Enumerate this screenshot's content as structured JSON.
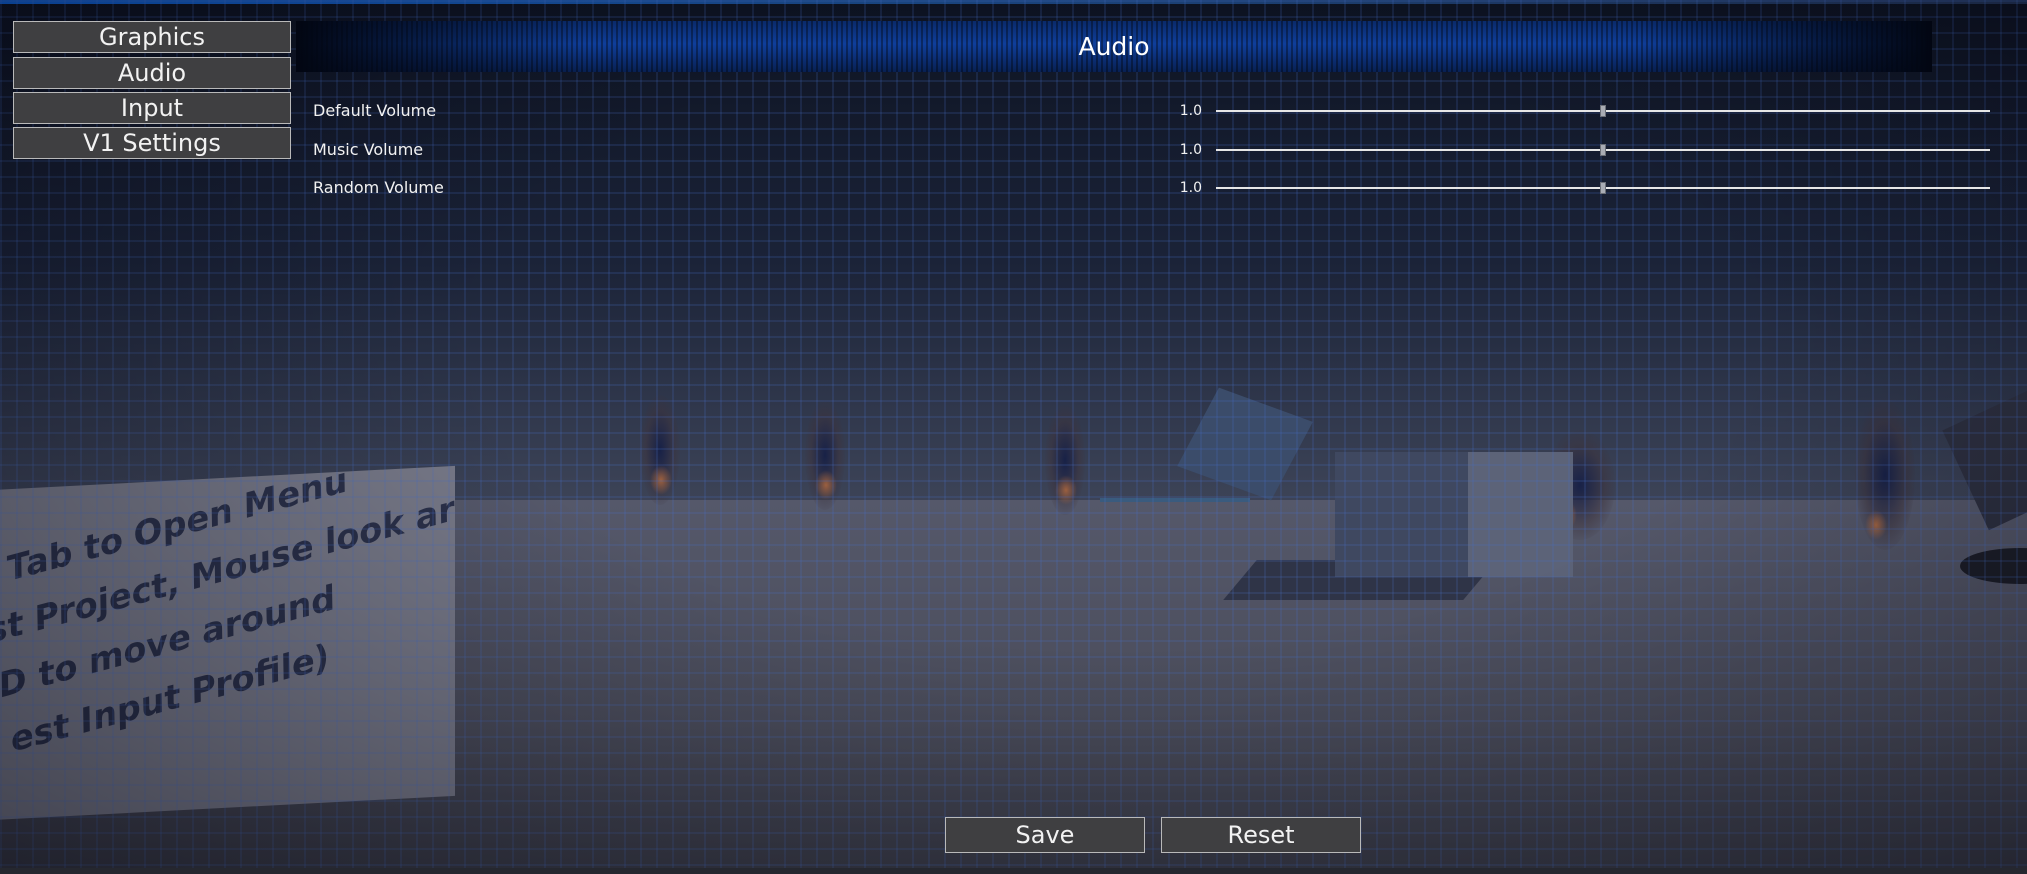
{
  "tabs": [
    {
      "label": "Graphics"
    },
    {
      "label": "Audio"
    },
    {
      "label": "Input"
    },
    {
      "label": "V1 Settings"
    }
  ],
  "panel": {
    "title": "Audio",
    "settings": [
      {
        "label": "Default Volume",
        "value": "1.0",
        "slider_fraction": 0.5
      },
      {
        "label": "Music Volume",
        "value": "1.0",
        "slider_fraction": 0.5
      },
      {
        "label": "Random Volume",
        "value": "1.0",
        "slider_fraction": 0.5
      }
    ]
  },
  "actions": {
    "save_label": "Save",
    "reset_label": "Reset"
  },
  "scene": {
    "wall_lines": [
      "s Tab to Open Menu",
      "st Project, Mouse look around,",
      "D to move around",
      "est Input Profile)"
    ]
  },
  "colors": {
    "header_blue": "#0f3e9a",
    "button_bg": "#3f3f41",
    "accent_top": "#0f5fd0"
  }
}
